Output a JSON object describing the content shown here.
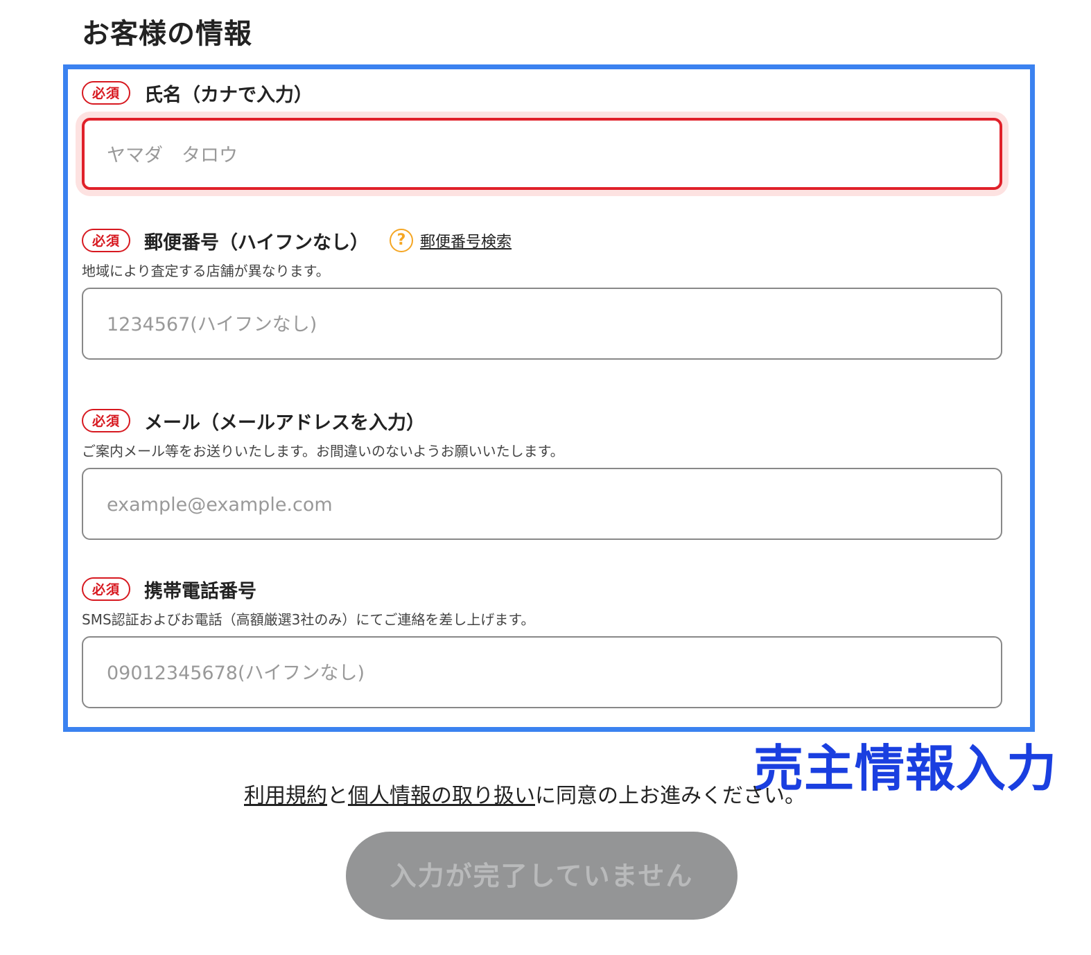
{
  "section_title": "お客様の情報",
  "annotation": "売主情報入力",
  "required_label": "必須",
  "fields": {
    "name": {
      "label": "氏名（カナで入力）",
      "placeholder": "ヤマダ　タロウ",
      "value": ""
    },
    "postal": {
      "label": "郵便番号（ハイフンなし）",
      "help_link": "郵便番号検索",
      "note": "地域により査定する店舗が異なります。",
      "placeholder": "1234567(ハイフンなし)",
      "value": ""
    },
    "email": {
      "label": "メール（メールアドレスを入力）",
      "note": "ご案内メール等をお送りいたします。お間違いのないようお願いいたします。",
      "placeholder": "example@example.com",
      "value": ""
    },
    "phone": {
      "label": "携帯電話番号",
      "note": "SMS認証およびお電話（高額厳選3社のみ）にてご連絡を差し上げます。",
      "placeholder": "09012345678(ハイフンなし)",
      "value": ""
    }
  },
  "consent": {
    "terms_link": "利用規約",
    "conj": "と",
    "privacy_link": "個人情報の取り扱い",
    "rest": "に同意の上お進みください。"
  },
  "submit_label": "入力が完了していません",
  "colors": {
    "required_red": "#d71920",
    "error_border": "#e0212a",
    "highlight_blue": "#3b82f0",
    "annotation_blue": "#1a3fe0",
    "disabled_button": "#949596",
    "help_icon": "#f5a623"
  },
  "icons": {
    "help": "question-circle-icon"
  }
}
